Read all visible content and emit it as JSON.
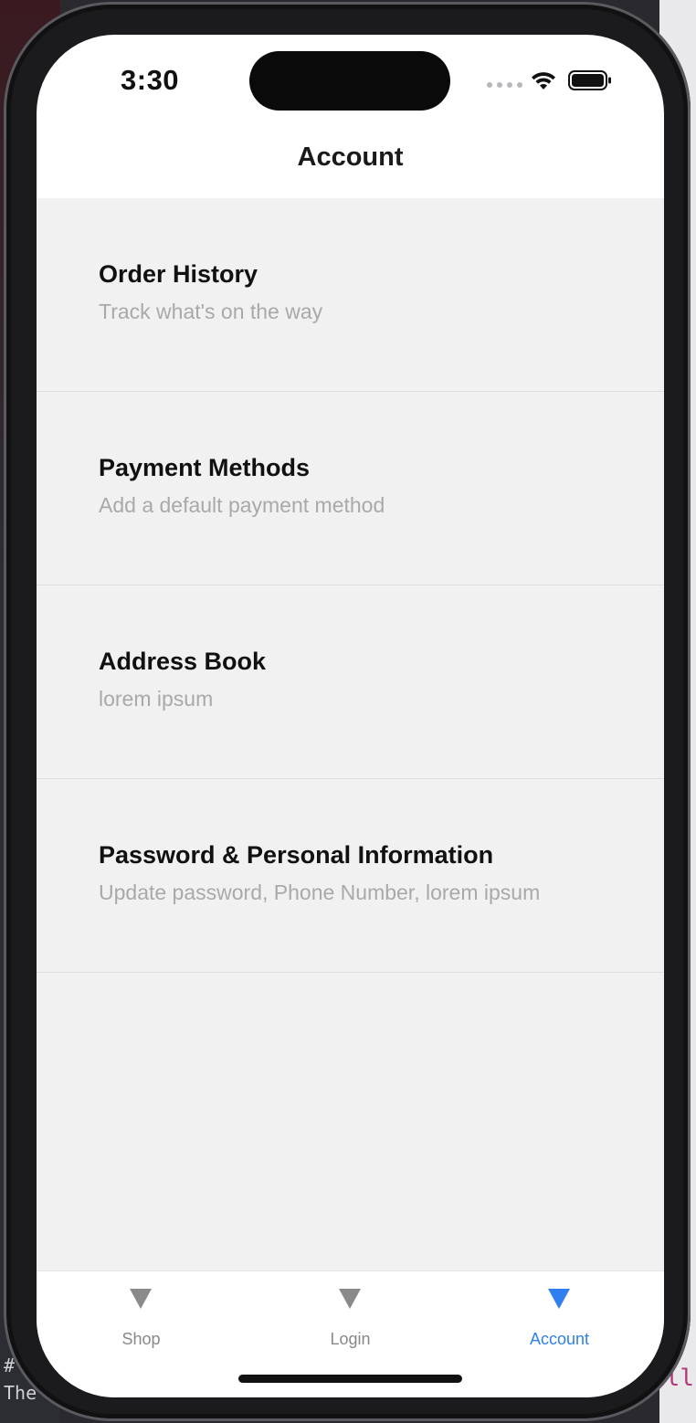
{
  "status_bar": {
    "time": "3:30",
    "icons": [
      "cellular-signal-icon",
      "wifi-icon",
      "battery-icon"
    ]
  },
  "nav": {
    "title": "Account"
  },
  "menu": {
    "items": [
      {
        "title": "Order History",
        "subtitle": "Track what's on the way"
      },
      {
        "title": "Payment Methods",
        "subtitle": "Add a default payment method"
      },
      {
        "title": "Address Book",
        "subtitle": "lorem ipsum"
      },
      {
        "title": "Password & Personal Information",
        "subtitle": "Update password, Phone Number, lorem ipsum"
      }
    ]
  },
  "tabbar": {
    "tabs": [
      {
        "label": "Shop",
        "icon": "triangle-down-icon",
        "active": false
      },
      {
        "label": "Login",
        "icon": "triangle-down-icon",
        "active": false
      },
      {
        "label": "Account",
        "icon": "triangle-down-icon",
        "active": true
      }
    ]
  },
  "colors": {
    "accent": "#2f7ff0",
    "inactive": "#888888",
    "content_background": "#f1f1f1"
  },
  "background": {
    "left_text_1": "#",
    "left_text_2": "The c",
    "right_text": "all"
  }
}
